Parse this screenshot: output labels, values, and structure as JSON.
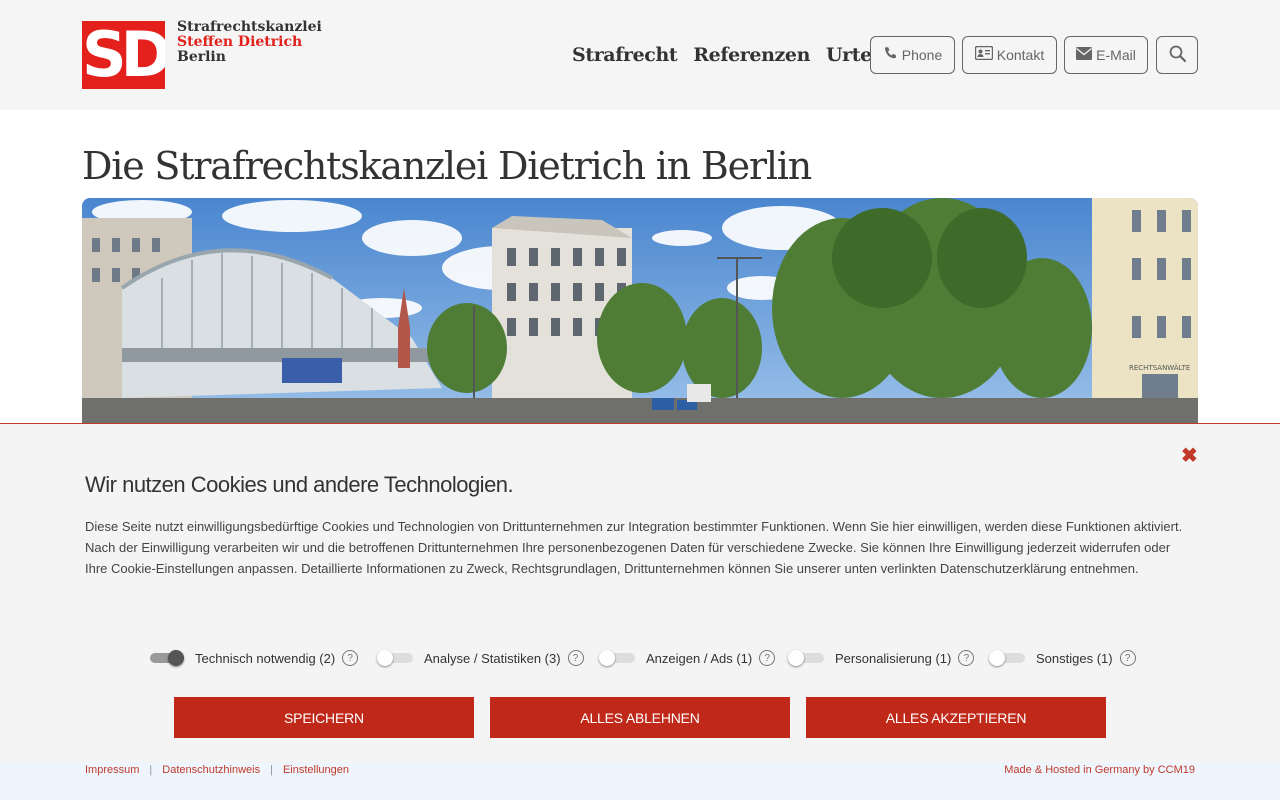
{
  "header": {
    "logo_mark": "SD",
    "logo_line1": "Strafrechtskanzlei",
    "logo_line2": "Steffen Dietrich",
    "logo_line3": "Berlin",
    "nav": [
      "Strafrecht",
      "Referenzen",
      "Urteile"
    ],
    "buttons": {
      "phone": "Phone",
      "kontakt": "Kontakt",
      "email": "E-Mail"
    },
    "icons": {
      "phone": "phone-icon",
      "kontakt": "id-card-icon",
      "email": "envelope-icon",
      "search": "search-icon"
    }
  },
  "main": {
    "title": "Die Strafrechtskanzlei Dietrich in Berlin",
    "hero_sign": "RECHTSANWÄLTE"
  },
  "cookie": {
    "title": "Wir nutzen Cookies und andere Technologien.",
    "text": "Diese Seite nutzt einwilligungsbedürftige Cookies und Technologien von Drittunternehmen zur Integration bestimmter Funktionen. Wenn Sie hier einwilligen, werden diese Funktionen aktiviert. Nach der Einwilligung verarbeiten wir und die betroffenen Drittunternehmen Ihre personenbezogenen Daten für verschiedene Zwecke. Sie können Ihre Einwilligung jederzeit widerrufen oder Ihre Cookie-Einstellungen anpassen. Detaillierte Informationen zu Zweck, Rechtsgrundlagen, Drittunternehmen können Sie unserer unten verlinkten Datenschutzerklärung entnehmen.",
    "toggles": [
      {
        "label": "Technisch notwendig (2)",
        "on": true
      },
      {
        "label": "Analyse / Statistiken (3)",
        "on": false
      },
      {
        "label": "Anzeigen / Ads (1)",
        "on": false
      },
      {
        "label": "Personalisierung (1)",
        "on": false
      },
      {
        "label": "Sonstiges (1)",
        "on": false
      }
    ],
    "help_glyph": "?",
    "buttons": {
      "save": "SPEICHERN",
      "reject": "ALLES ABLEHNEN",
      "accept": "ALLES AKZEPTIEREN"
    },
    "close_glyph": "✖"
  },
  "footer": {
    "links": [
      "Impressum",
      "Datenschutzhinweis",
      "Einstellungen"
    ],
    "separator": "|",
    "made": "Made & Hosted in Germany by CCM19"
  },
  "colors": {
    "brand_red": "#e3201b",
    "button_red": "#c0291a",
    "text": "#333333"
  }
}
